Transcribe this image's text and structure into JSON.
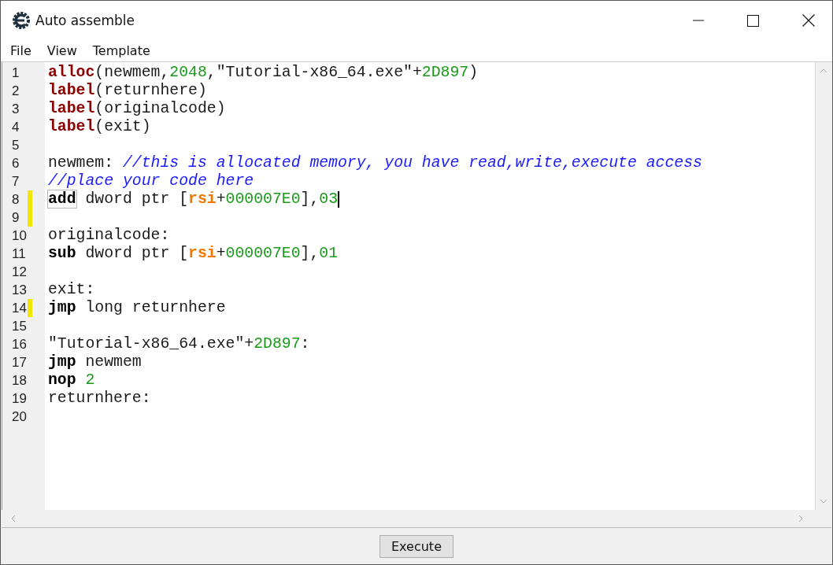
{
  "window": {
    "title": "Auto assemble"
  },
  "menu": [
    "File",
    "View",
    "Template"
  ],
  "editor": {
    "lines": [
      {
        "number": "1",
        "marked": false,
        "cursor": false,
        "tokens": [
          {
            "text": "alloc",
            "kind": "directive"
          },
          {
            "text": "(newmem,",
            "kind": "plain"
          },
          {
            "text": "2048",
            "kind": "number"
          },
          {
            "text": ",\"Tutorial-x86_64.exe\"+",
            "kind": "plain"
          },
          {
            "text": "2D897",
            "kind": "number"
          },
          {
            "text": ")",
            "kind": "plain"
          }
        ]
      },
      {
        "number": "2",
        "marked": false,
        "cursor": false,
        "tokens": [
          {
            "text": "label",
            "kind": "directive"
          },
          {
            "text": "(returnhere)",
            "kind": "plain"
          }
        ]
      },
      {
        "number": "3",
        "marked": false,
        "cursor": false,
        "tokens": [
          {
            "text": "label",
            "kind": "directive"
          },
          {
            "text": "(originalcode)",
            "kind": "plain"
          }
        ]
      },
      {
        "number": "4",
        "marked": false,
        "cursor": false,
        "tokens": [
          {
            "text": "label",
            "kind": "directive"
          },
          {
            "text": "(exit)",
            "kind": "plain"
          }
        ]
      },
      {
        "number": "5",
        "marked": false,
        "cursor": false
      },
      {
        "number": "6",
        "marked": false,
        "cursor": false,
        "tokens": [
          {
            "text": "newmem: ",
            "kind": "plain"
          },
          {
            "text": "//this is allocated memory, you have read,write,execute access",
            "kind": "comment"
          }
        ]
      },
      {
        "number": "7",
        "marked": false,
        "cursor": false,
        "tokens": [
          {
            "text": "//place your code here",
            "kind": "comment"
          }
        ]
      },
      {
        "number": "8",
        "marked": true,
        "cursor": true,
        "tokens": [
          {
            "text": "add",
            "kind": "instruction",
            "boxed": true
          },
          {
            "text": " dword ptr [",
            "kind": "plain"
          },
          {
            "text": "rsi",
            "kind": "register"
          },
          {
            "text": "+",
            "kind": "plain"
          },
          {
            "text": "000007E0",
            "kind": "number"
          },
          {
            "text": "],",
            "kind": "plain"
          },
          {
            "text": "03",
            "kind": "number"
          }
        ]
      },
      {
        "number": "9",
        "marked": true,
        "cursor": false
      },
      {
        "number": "10",
        "marked": false,
        "cursor": false,
        "tokens": [
          {
            "text": "originalcode:",
            "kind": "plain"
          }
        ]
      },
      {
        "number": "11",
        "marked": false,
        "cursor": false,
        "tokens": [
          {
            "text": "sub",
            "kind": "instruction"
          },
          {
            "text": " dword ptr [",
            "kind": "plain"
          },
          {
            "text": "rsi",
            "kind": "register"
          },
          {
            "text": "+",
            "kind": "plain"
          },
          {
            "text": "000007E0",
            "kind": "number"
          },
          {
            "text": "],",
            "kind": "plain"
          },
          {
            "text": "01",
            "kind": "number"
          }
        ]
      },
      {
        "number": "12",
        "marked": false,
        "cursor": false
      },
      {
        "number": "13",
        "marked": false,
        "cursor": false,
        "tokens": [
          {
            "text": "exit:",
            "kind": "plain"
          }
        ]
      },
      {
        "number": "14",
        "marked": true,
        "cursor": false,
        "tokens": [
          {
            "text": "jmp",
            "kind": "instruction"
          },
          {
            "text": " long returnhere",
            "kind": "plain"
          }
        ]
      },
      {
        "number": "15",
        "marked": false,
        "cursor": false
      },
      {
        "number": "16",
        "marked": false,
        "cursor": false,
        "tokens": [
          {
            "text": "\"Tutorial-x86_64.exe\"+",
            "kind": "plain"
          },
          {
            "text": "2D897",
            "kind": "number"
          },
          {
            "text": ":",
            "kind": "plain"
          }
        ]
      },
      {
        "number": "17",
        "marked": false,
        "cursor": false,
        "tokens": [
          {
            "text": "jmp",
            "kind": "instruction"
          },
          {
            "text": " newmem",
            "kind": "plain"
          }
        ]
      },
      {
        "number": "18",
        "marked": false,
        "cursor": false,
        "tokens": [
          {
            "text": "nop",
            "kind": "instruction"
          },
          {
            "text": " 2",
            "kind": "number"
          }
        ]
      },
      {
        "number": "19",
        "marked": false,
        "cursor": false,
        "tokens": [
          {
            "text": "returnhere:",
            "kind": "plain"
          }
        ]
      },
      {
        "number": "20",
        "marked": false,
        "cursor": false
      }
    ]
  },
  "buttons": [
    "Execute"
  ]
}
